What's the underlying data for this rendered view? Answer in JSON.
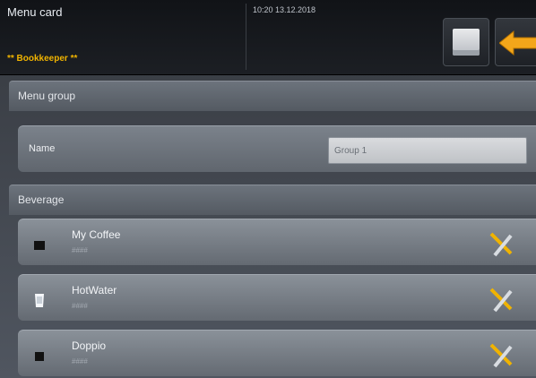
{
  "header": {
    "title": "Menu card",
    "role": "** Bookkeeper **",
    "datetime": "10:20 13.12.2018"
  },
  "menu_group": {
    "section_label": "Menu group",
    "name_label": "Name",
    "name_value": "Group 1"
  },
  "beverage": {
    "section_label": "Beverage",
    "items": [
      {
        "name": "My Coffee",
        "sub": "####",
        "icon": "cup-dark-icon"
      },
      {
        "name": "HotWater",
        "sub": "####",
        "icon": "glass-water-icon"
      },
      {
        "name": "Doppio",
        "sub": "####",
        "icon": "cup-dark-icon"
      }
    ]
  },
  "icons": {
    "save": "save-icon",
    "back": "back-arrow-icon",
    "edit": "tools-icon"
  },
  "colors": {
    "accent": "#f0b300",
    "header_bg": "#15181c",
    "field_bg": "#d9dbde"
  }
}
